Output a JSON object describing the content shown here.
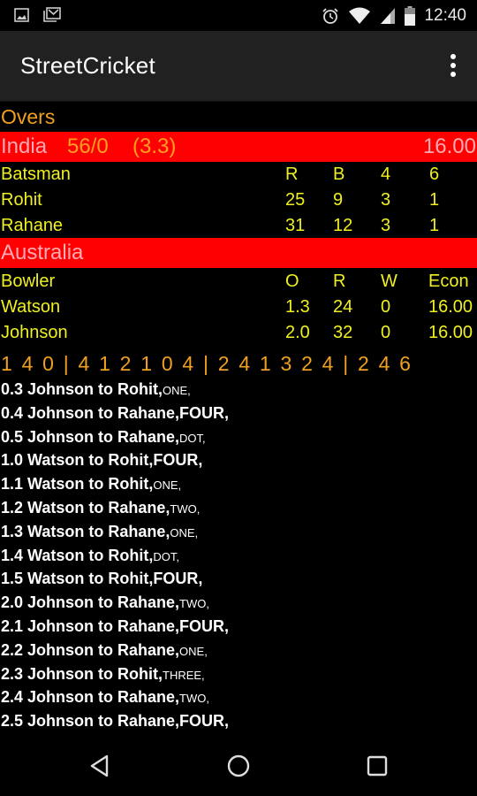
{
  "status_bar": {
    "time": "12:40",
    "left_icons": [
      "image-notification-icon",
      "gmail-notification-icon"
    ],
    "right_icons": [
      "alarm-icon",
      "wifi-icon",
      "cell-signal-icon",
      "battery-icon"
    ]
  },
  "app_bar": {
    "title": "StreetCricket",
    "menu_icon": "overflow-menu-icon"
  },
  "scorecard": {
    "overs_label": "Overs",
    "batting_team": {
      "name": "India",
      "score": "56/0",
      "overs": "(3.3)",
      "run_rate": "16.00"
    },
    "batting_header": [
      "Batsman",
      "R",
      "B",
      "4",
      "6"
    ],
    "batsmen": [
      {
        "name": "Rohit",
        "r": "25",
        "b": "9",
        "fours": "3",
        "sixes": "1"
      },
      {
        "name": "Rahane",
        "r": "31",
        "b": "12",
        "fours": "3",
        "sixes": "1"
      }
    ],
    "bowling_team": {
      "name": "Australia"
    },
    "bowling_header": [
      "Bowler",
      "O",
      "R",
      "W",
      "Econ"
    ],
    "bowlers": [
      {
        "name": "Watson",
        "o": "1.3",
        "r": "24",
        "w": "0",
        "econ": "16.00"
      },
      {
        "name": "Johnson",
        "o": "2.0",
        "r": "32",
        "w": "0",
        "econ": "16.00"
      }
    ],
    "ball_strip": "1 4 0 | 4 1 2 1 0 4 | 2 4 1 3 2 4 | 2 4 6"
  },
  "commentary": [
    {
      "text": "0.3 Johnson to Rohit,",
      "result": "ONE,",
      "big": false
    },
    {
      "text": "0.4 Johnson to Rahane,",
      "result": "FOUR,",
      "big": true
    },
    {
      "text": "0.5 Johnson to Rahane,",
      "result": "DOT,",
      "big": false
    },
    {
      "text": "1.0 Watson to Rohit,",
      "result": "FOUR,",
      "big": true
    },
    {
      "text": "1.1 Watson to Rohit,",
      "result": "ONE,",
      "big": false
    },
    {
      "text": "1.2 Watson to Rahane,",
      "result": "TWO,",
      "big": false
    },
    {
      "text": "1.3 Watson to Rahane,",
      "result": "ONE,",
      "big": false
    },
    {
      "text": "1.4 Watson to Rohit,",
      "result": "DOT,",
      "big": false
    },
    {
      "text": "1.5 Watson to Rohit,",
      "result": "FOUR,",
      "big": true
    },
    {
      "text": "2.0 Johnson to Rahane,",
      "result": "TWO,",
      "big": false
    },
    {
      "text": "2.1 Johnson to Rahane,",
      "result": "FOUR,",
      "big": true
    },
    {
      "text": "2.2 Johnson to Rahane,",
      "result": "ONE,",
      "big": false
    },
    {
      "text": "2.3 Johnson to Rohit,",
      "result": "THREE,",
      "big": false
    },
    {
      "text": "2.4 Johnson to Rahane,",
      "result": "TWO,",
      "big": false
    },
    {
      "text": "2.5 Johnson to Rahane,",
      "result": "FOUR,",
      "big": true
    }
  ],
  "nav_bar": {
    "buttons": [
      "back",
      "home",
      "recent-apps"
    ]
  },
  "colors": {
    "team_bar": "#ff0000",
    "accent_orange": "#f0a020",
    "stats_yellow": "#f0f020",
    "team_name_pink": "#ffaab4",
    "app_bar": "#212121"
  }
}
